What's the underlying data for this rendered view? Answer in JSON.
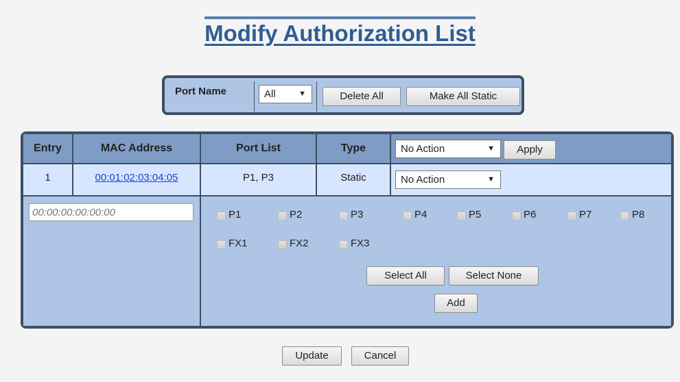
{
  "page": {
    "title": "Modify Authorization List"
  },
  "port_filter": {
    "label": "Port Name",
    "selected": "All",
    "delete_all_label": "Delete All",
    "make_all_static_label": "Make All Static"
  },
  "table": {
    "columns": [
      "Entry",
      "MAC Address",
      "Port List",
      "Type"
    ],
    "header_action": {
      "selected": "No Action",
      "apply_label": "Apply"
    },
    "rows": [
      {
        "entry": "1",
        "mac": "00:01:02:03:04:05",
        "ports": "P1, P3",
        "type": "Static",
        "action": "No Action"
      }
    ],
    "new_entry": {
      "mac_placeholder": "00:00:00:00:00:00",
      "ports": [
        "P1",
        "P2",
        "P3",
        "P4",
        "P5",
        "P6",
        "P7",
        "P8",
        "FX1",
        "FX2",
        "FX3"
      ],
      "select_all_label": "Select All",
      "select_none_label": "Select None",
      "add_label": "Add"
    }
  },
  "footer": {
    "update_label": "Update",
    "cancel_label": "Cancel"
  },
  "colors": {
    "title": "#2f5d94",
    "frame": "#3d4f66",
    "header": "#7f9cc4",
    "row": "#d7e6ff",
    "panel": "#aec5e6"
  }
}
